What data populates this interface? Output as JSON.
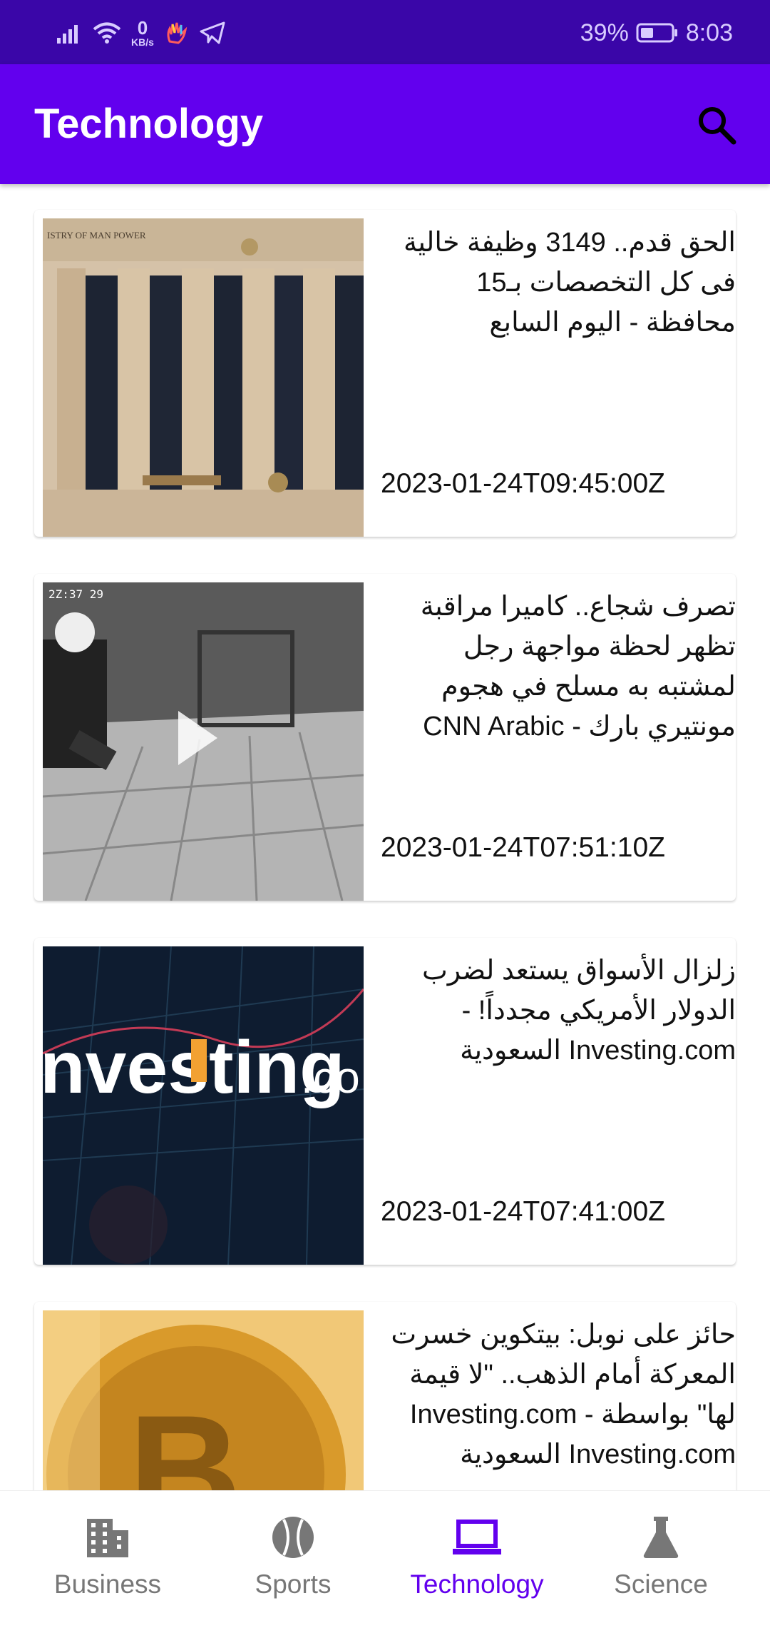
{
  "status_bar": {
    "data_speed_value": "0",
    "data_speed_unit": "KB/s",
    "battery_percent": "39%",
    "time": "8:03"
  },
  "app_bar": {
    "title": "Technology",
    "search_icon": "search-icon"
  },
  "articles": [
    {
      "headline": "الحق قدم.. 3149 وظيفة خالية فى كل التخصصات بـ15 محافظة - اليوم السابع",
      "published": "2023-01-24T09:45:00Z",
      "thumb_text": "ISTRY OF MAN POWER"
    },
    {
      "headline": "تصرف شجاع.. كاميرا مراقبة تظهر لحظة مواجهة رجل لمشتبه به مسلح في هجوم مونتيري بارك - CNN Arabic",
      "published": "2023-01-24T07:51:10Z",
      "thumb_text": "2Z:37 29"
    },
    {
      "headline": "زلزال الأسواق يستعد لضرب الدولار الأمريكي مجدداً! - Investing.com السعودية",
      "published": "2023-01-24T07:41:00Z",
      "thumb_text": "nvesting",
      "thumb_text_suffix": ".co"
    },
    {
      "headline": "حائز على نوبل: بيتكوين خسرت المعركة أمام الذهب.. \"لا قيمة لها\" بواسطة Investing.com - Investing.com السعودية",
      "published": "",
      "thumb_text": ""
    }
  ],
  "bottom_nav": [
    {
      "label": "Business",
      "icon": "building-icon",
      "active": false
    },
    {
      "label": "Sports",
      "icon": "ball-icon",
      "active": false
    },
    {
      "label": "Technology",
      "icon": "laptop-icon",
      "active": true
    },
    {
      "label": "Science",
      "icon": "flask-icon",
      "active": false
    }
  ],
  "colors": {
    "primary": "#6200ee",
    "status_bar": "#3a06a8",
    "nav_inactive": "#777777"
  }
}
